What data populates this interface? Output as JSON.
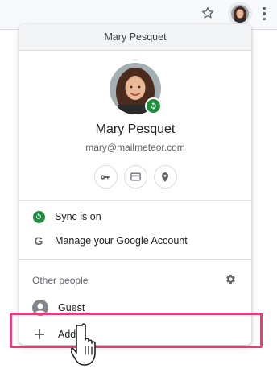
{
  "toolbar": {
    "star_icon": "star-outline-icon",
    "avatar_icon": "profile-avatar-icon",
    "menu_icon": "more-vert-icon"
  },
  "profile_menu": {
    "header_title": "Mary Pesquet",
    "user_name": "Mary Pesquet",
    "user_email": "mary@mailmeteor.com",
    "quick_buttons": [
      {
        "icon": "key-icon"
      },
      {
        "icon": "credit-card-icon"
      },
      {
        "icon": "location-pin-icon"
      }
    ],
    "sync_label": "Sync is on",
    "manage_account_label": "Manage your Google Account",
    "other_people_label": "Other people",
    "guest_label": "Guest",
    "add_label": "Add"
  },
  "colors": {
    "sync_green": "#1e8e3e",
    "highlight_pink": "#e53d7a",
    "header_bg": "#f1f3f4"
  }
}
